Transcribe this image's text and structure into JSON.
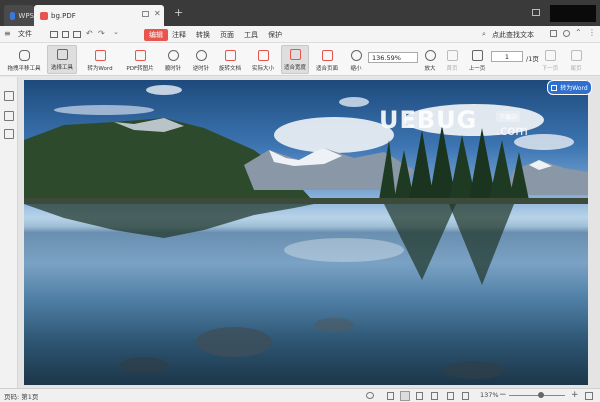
{
  "titlebar": {
    "wps_tab_label": "WPS",
    "pdf_tab_label": "bg.PDF",
    "new_tab_symbol": "+",
    "colors": {
      "bar": "#3a3a3a",
      "brand": "#3c78d8",
      "pdf_badge": "#e8554e"
    }
  },
  "menubar": {
    "items": [
      "文件",
      "编辑",
      "注释",
      "转换",
      "页面",
      "工具",
      "保护"
    ],
    "active_index": 1,
    "search_label": "点此查找文本"
  },
  "toolbar": {
    "buttons": [
      "拖拽平移工具",
      "选择工具",
      "转为Word",
      "PDF转图片",
      "顺时针",
      "逆时针",
      "旋转文档",
      "实际大小",
      "适合宽度",
      "适合页面",
      "缩小",
      "放大",
      "首页",
      "上一页",
      "下一页",
      "尾页"
    ],
    "zoom_value": "136.59%",
    "page_input": "1",
    "page_total": "/1页"
  },
  "canvas": {
    "convert_button_label": "转为Word",
    "watermark_main": "UEBUG",
    "watermark_sub": ".com",
    "watermark_tag": "下载站"
  },
  "statusbar": {
    "page_label": "页码: 第1页",
    "zoom_percent": "137%"
  }
}
